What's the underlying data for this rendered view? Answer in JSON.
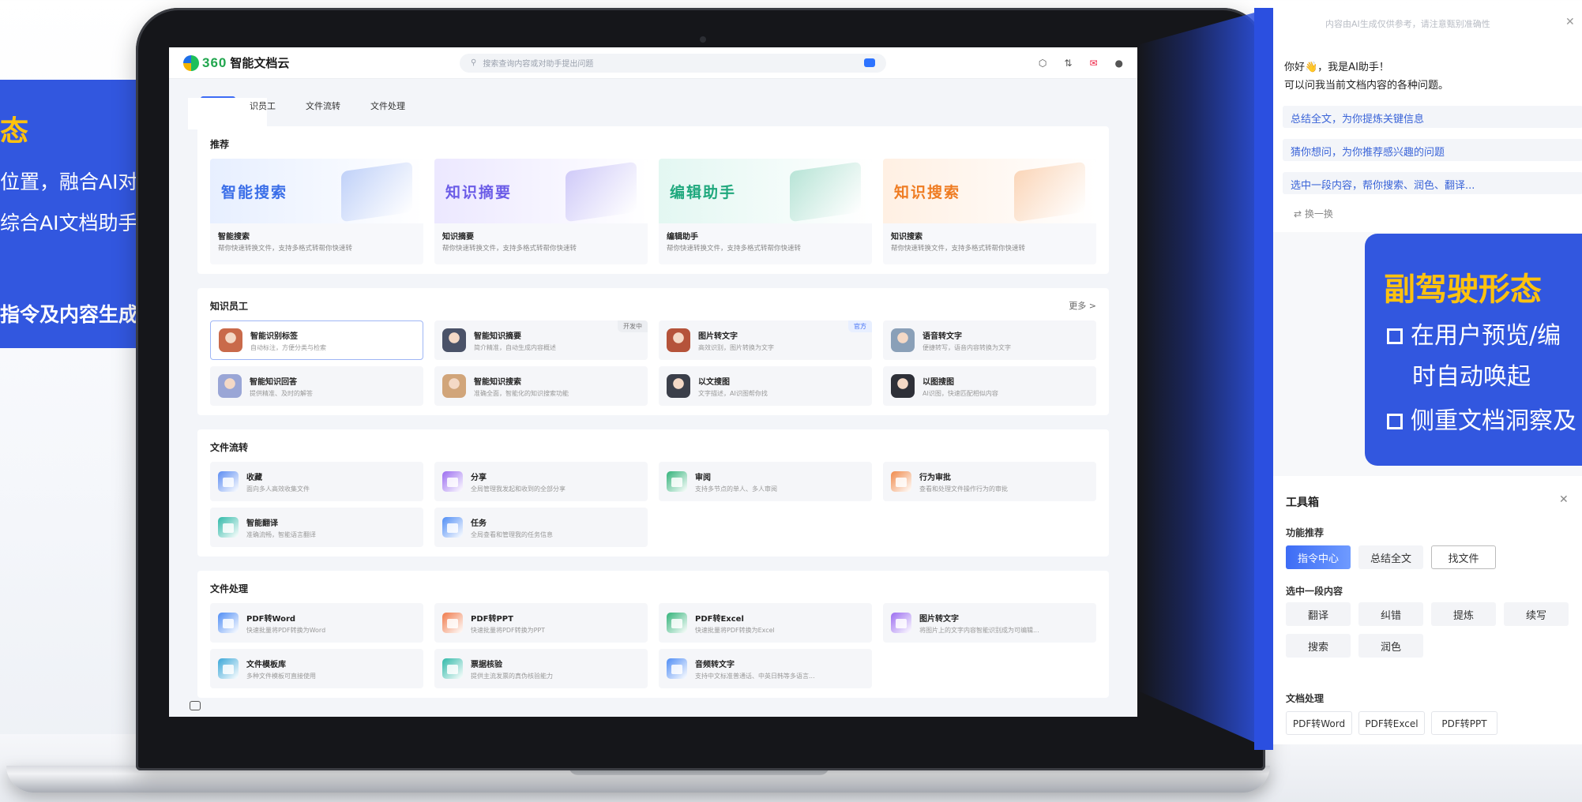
{
  "app": {
    "logo_num": "360",
    "logo_text": "智能文档云",
    "search_placeholder": "搜索查询内容或对助手提出问题",
    "top_icons": [
      "cube-icon",
      "sort-icon",
      "message-icon",
      "user-avatar-icon"
    ]
  },
  "tabs": [
    "识员工",
    "文件流转",
    "文件处理"
  ],
  "recommend": {
    "title": "推荐",
    "cards": [
      {
        "banner": "智能搜索",
        "name": "智能搜索",
        "desc": "帮你快速转换文件，支持多格式转帮你快速转",
        "color": "#e7efff",
        "text_color": "#3a6ee8"
      },
      {
        "banner": "知识摘要",
        "name": "知识摘要",
        "desc": "帮你快速转换文件，支持多格式转帮你快速转",
        "color": "#ece8ff",
        "text_color": "#6b5ce7"
      },
      {
        "banner": "编辑助手",
        "name": "编辑助手",
        "desc": "帮你快速转换文件，支持多格式转帮你快速转",
        "color": "#e3f7f2",
        "text_color": "#1fa87d"
      },
      {
        "banner": "知识搜索",
        "name": "知识搜索",
        "desc": "帮你快速转换文件，支持多格式转帮你快速转",
        "color": "#fff0e3",
        "text_color": "#ef7c22"
      }
    ]
  },
  "knowledge_staff": {
    "title": "知识员工",
    "more": "更多 >",
    "items": [
      {
        "name": "智能识别标签",
        "desc": "自动标注，方便分类与检索",
        "badge": "",
        "color": "#c96a4a"
      },
      {
        "name": "智能知识摘要",
        "desc": "简介精准，自动生成内容概述",
        "badge": "开发中",
        "color": "#4a5268"
      },
      {
        "name": "图片转文字",
        "desc": "高效识别，图片转换为文字",
        "badge": "官方",
        "color": "#b5533a"
      },
      {
        "name": "语音转文字",
        "desc": "便捷转写，语音内容转换为文字",
        "badge": "",
        "color": "#8aa0b8"
      },
      {
        "name": "智能知识回答",
        "desc": "提供精准、及时的解答",
        "badge": "",
        "color": "#9aa6d6"
      },
      {
        "name": "智能知识搜索",
        "desc": "准确全面，智能化的知识搜索功能",
        "badge": "",
        "color": "#d1a57a"
      },
      {
        "name": "以文搜图",
        "desc": "文字描述，AI识图帮你找",
        "badge": "",
        "color": "#3b3f4a"
      },
      {
        "name": "以图搜图",
        "desc": "AI识图，快速匹配相似内容",
        "badge": "",
        "color": "#2e3038"
      }
    ]
  },
  "file_flow": {
    "title": "文件流转",
    "items": [
      {
        "name": "收藏",
        "desc": "面向多人高效收集文件",
        "color": "#5b8cf2"
      },
      {
        "name": "分享",
        "desc": "全局管理我发起和收到的全部分享",
        "color": "#9b6cf0"
      },
      {
        "name": "审阅",
        "desc": "支持多节点的单人、多人审阅",
        "color": "#33b37a"
      },
      {
        "name": "行为审批",
        "desc": "查看和处理文件操作行为的审批",
        "color": "#f08a4b"
      },
      {
        "name": "智能翻译",
        "desc": "准确流畅，智能语言翻译",
        "color": "#2fb9a8"
      },
      {
        "name": "任务",
        "desc": "全局查看和管理我的任务信息",
        "color": "#4f8df5"
      }
    ]
  },
  "file_process": {
    "title": "文件处理",
    "items": [
      {
        "name": "PDF转Word",
        "desc": "快速批量将PDF转换为Word",
        "color": "#4f8df5"
      },
      {
        "name": "PDF转PPT",
        "desc": "快速批量将PDF转换为PPT",
        "color": "#f07a4b"
      },
      {
        "name": "PDF转Excel",
        "desc": "快速批量将PDF转换为Excel",
        "color": "#33b37a"
      },
      {
        "name": "图片转文字",
        "desc": "将图片上的文字内容智能识别成为可编辑...",
        "color": "#9b6cf0"
      },
      {
        "name": "文件模板库",
        "desc": "多种文件模板可直接使用",
        "color": "#3aa7d8"
      },
      {
        "name": "票据核验",
        "desc": "提供主流发票的真伪核验能力",
        "color": "#2fb9a8"
      },
      {
        "name": "音频转文字",
        "desc": "支持中文标准普通话、中英日韩等多语言...",
        "color": "#4f8df5"
      }
    ]
  },
  "left_callout": {
    "title": "态",
    "line1": "位置，融合AI对话、",
    "line2": "综合AI文档助手能",
    "bold": "指令及内容生成"
  },
  "assistant": {
    "notice": "内容由AI生成仅供参考，请注意甄别准确性",
    "greet1": "你好👋，我是AI助手！",
    "greet2": "可以问我当前文档内容的各种问题。",
    "suggestions": [
      "总结全文，为你提炼关键信息",
      "猜你想问，为你推荐感兴趣的问题",
      "选中一段内容，帮你搜索、润色、翻译..."
    ],
    "refresh": "换一换"
  },
  "toolbox": {
    "title": "工具箱",
    "func_title": "功能推荐",
    "func_buttons": [
      "指令中心",
      "总结全文",
      "找文件"
    ],
    "select_title": "选中一段内容",
    "select_buttons": [
      "翻译",
      "纠错",
      "提炼",
      "续写",
      "搜索",
      "润色"
    ],
    "doc_title": "文档处理",
    "doc_buttons": [
      "PDF转Word",
      "PDF转Excel",
      "PDF转PPT"
    ]
  },
  "right_callout": {
    "title": "副驾驶形态",
    "line1": "在用户预览/编",
    "line2": "时自动唤起",
    "line3": "侧重文档洞察及"
  }
}
